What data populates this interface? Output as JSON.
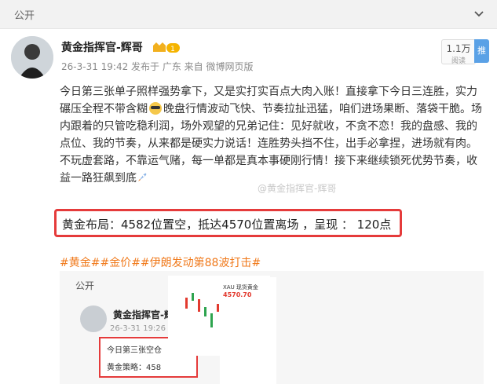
{
  "topbar": {
    "label": "公开"
  },
  "post": {
    "author": "黄金指挥官-辉哥",
    "badge_level": "1",
    "meta": "26-3-31 19:42 发布于 广东 来自 微博网页版",
    "views": "1.1万",
    "views_label": "阅读",
    "promo_label": "推广",
    "text_a": "今日第三张单子照样强势拿下，又是实打实百点大肉入账！直接拿下今日三连胜，实力碾压全程不带含糊",
    "text_b": "晚盘行情波动飞快、节奏拉扯迅猛，咱们进场果断、落袋干脆。场内跟着的只管吃稳利润，场外观望的兄弟记住：见好就收，不贪不恋！我的盘感、我的点位、我的节奏，从来都是硬实力说话！连胜势头挡不住，出手必拿捏，进场就有肉。不玩虚套路，不靠运气赌，每一单都是真本事硬刚行情！接下来继续锁死优势节奏，收益一路狂飙到底",
    "watermark": "@黄金指挥官-辉哥",
    "highlight": "黄金布局：4582位置空，抵达4570位置离场 ，呈现 ： 120点",
    "tags": "#黄金##金价##伊朗发动第88波打击#"
  },
  "embed": {
    "label": "公开",
    "author": "黄金指挥官-辉",
    "meta": "26-3-31 19:26",
    "line1": "今日第三张空仓",
    "line2": "黄金策略：458",
    "table_title": "XAU 现货黄金",
    "table_price": "4570.70"
  },
  "colors": {
    "accent": "#f07a1c",
    "highlight_border": "#e53b3b",
    "promo": "#5aa1e6"
  }
}
